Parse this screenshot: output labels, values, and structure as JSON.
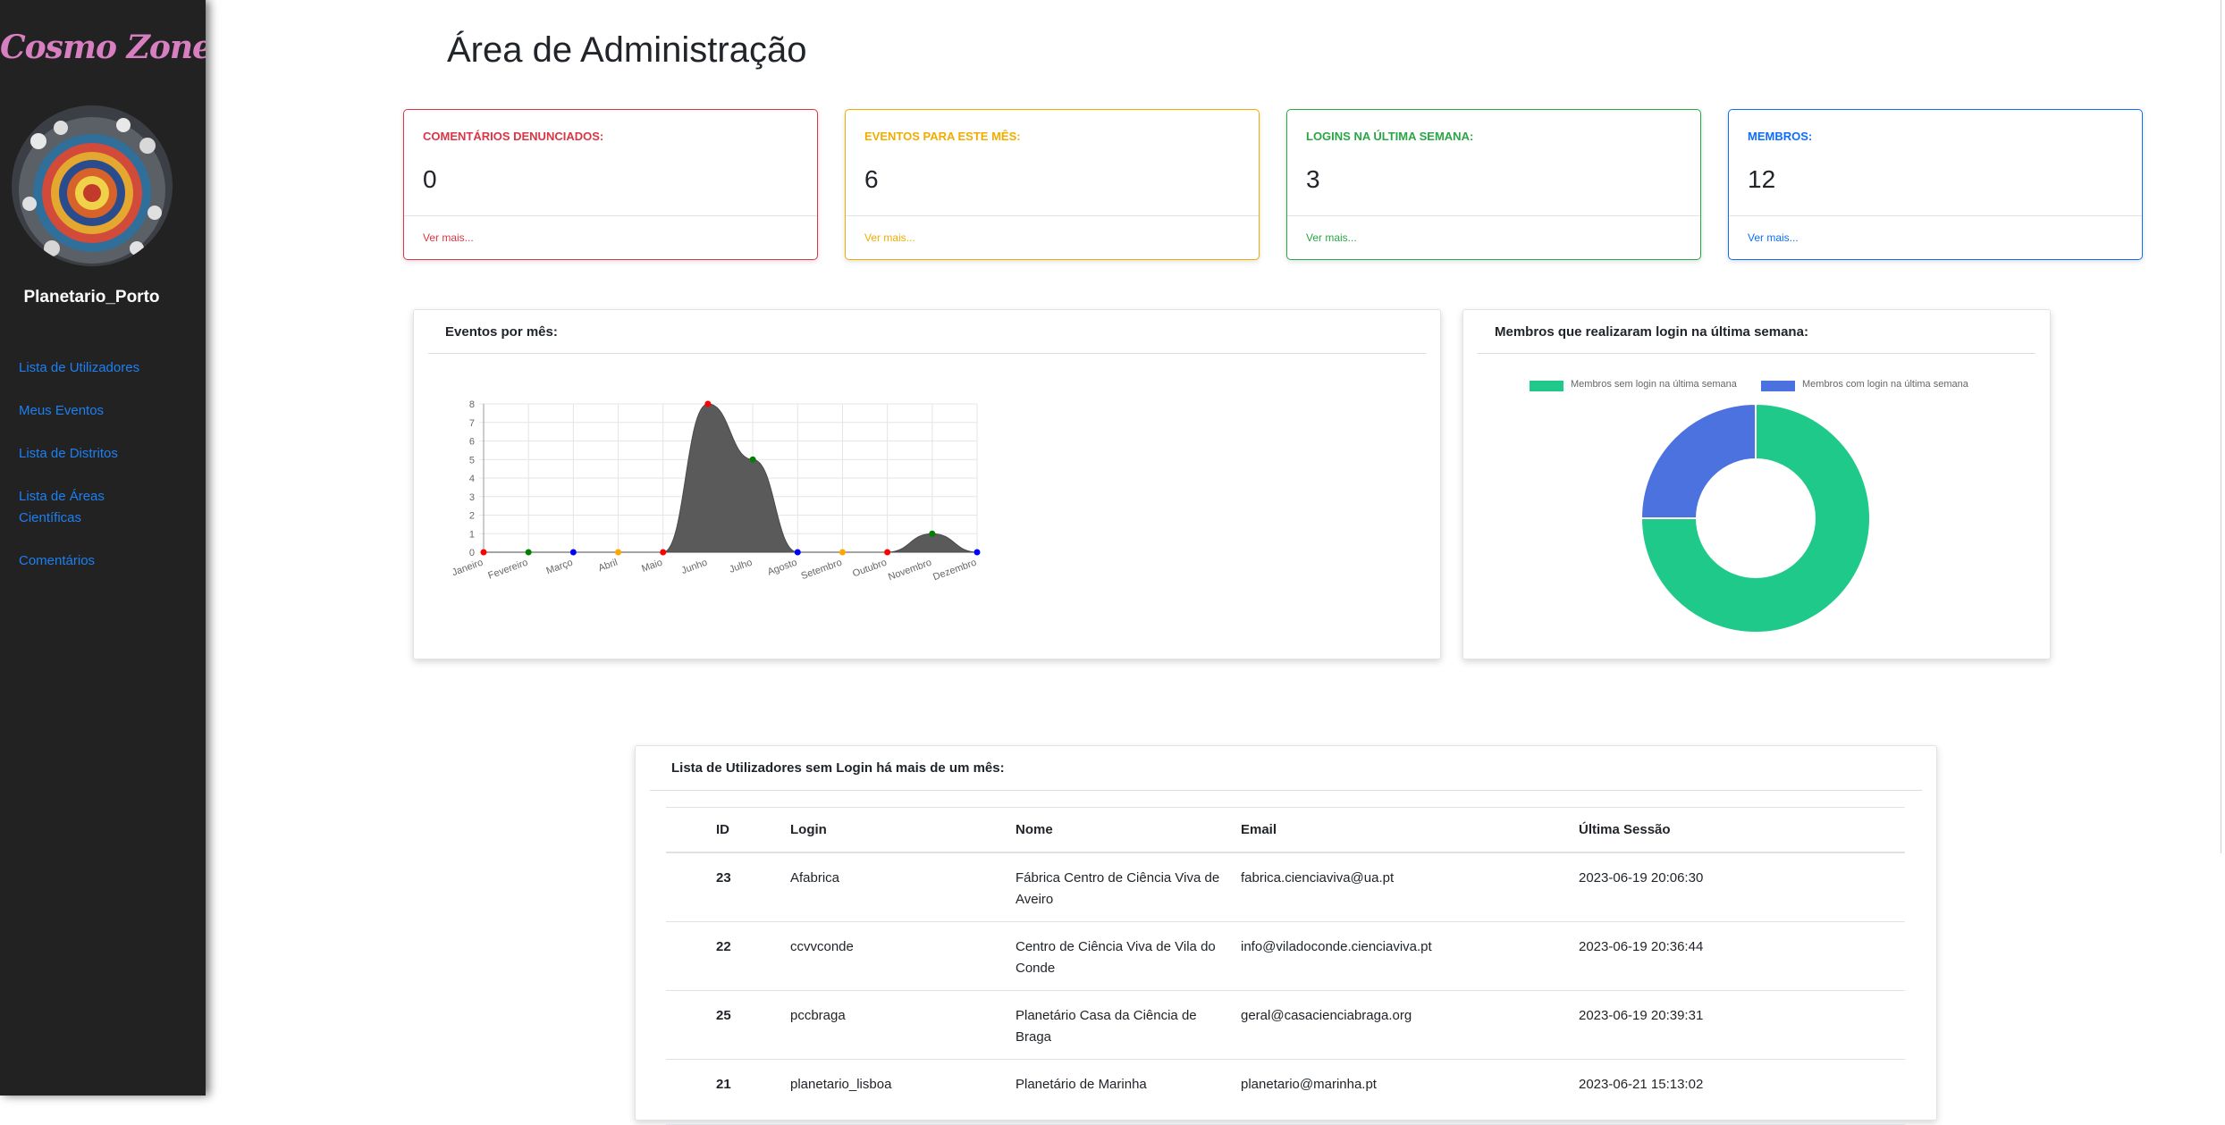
{
  "app": {
    "brand": "Cosmo Zone",
    "username": "Planetario_Porto"
  },
  "sidebar": {
    "items": [
      {
        "label": "Lista de Utilizadores"
      },
      {
        "label": "Meus Eventos"
      },
      {
        "label": "Lista de Distritos"
      },
      {
        "label": "Lista de Áreas Científicas"
      },
      {
        "label": "Comentários"
      }
    ]
  },
  "page": {
    "title": "Área de Administração"
  },
  "stats": [
    {
      "label": "Comentários denunciados:",
      "value": "0",
      "link": "Ver mais...",
      "color": "#dc3545"
    },
    {
      "label": "Eventos para este mês:",
      "value": "6",
      "link": "Ver mais...",
      "color": "#f0ad00"
    },
    {
      "label": "Logins na última semana:",
      "value": "3",
      "link": "Ver mais...",
      "color": "#28a745"
    },
    {
      "label": "Membros:",
      "value": "12",
      "link": "Ver mais...",
      "color": "#0d6efd"
    }
  ],
  "events_panel": {
    "title": "Eventos por mês:"
  },
  "logins_panel": {
    "title": "Membros que realizaram login na última semana:"
  },
  "chart_data": [
    {
      "type": "area",
      "categories": [
        "Janeiro",
        "Fevereiro",
        "Março",
        "Abril",
        "Maio",
        "Junho",
        "Julho",
        "Agosto",
        "Setembro",
        "Outubro",
        "Novembro",
        "Dezembro"
      ],
      "values": [
        0,
        0,
        0,
        0,
        0,
        8,
        5,
        0,
        0,
        0,
        1,
        0
      ],
      "point_colors": [
        "#ff0000",
        "#008000",
        "#0000ff",
        "#ffa500",
        "#ff0000",
        "#ff0000",
        "#008000",
        "#0000ff",
        "#ffa500",
        "#ff0000",
        "#008000",
        "#0000ff"
      ],
      "yticks": [
        "0",
        "1",
        "2",
        "3",
        "4",
        "5",
        "6",
        "7",
        "8"
      ],
      "ylim": [
        0,
        8
      ],
      "fill_color": "#5a5a5a",
      "grid": true
    },
    {
      "type": "pie",
      "legend": "top",
      "labels": [
        "Membros sem login na última semana",
        "Membros com login na última semana"
      ],
      "values": [
        9,
        3
      ],
      "colors": [
        "#1ec98a",
        "#4c72df"
      ]
    }
  ],
  "users_table": {
    "title": "Lista de Utilizadores sem Login há mais de um mês:",
    "headers": [
      "ID",
      "Login",
      "Nome",
      "Email",
      "Última Sessão"
    ],
    "rows": [
      [
        "23",
        "Afabrica",
        "Fábrica Centro de Ciência Viva de Aveiro",
        "fabrica.cienciaviva@ua.pt",
        "2023-06-19 20:06:30"
      ],
      [
        "22",
        "ccvvconde",
        "Centro de Ciência Viva de Vila do Conde",
        "info@viladoconde.cienciaviva.pt",
        "2023-06-19 20:36:44"
      ],
      [
        "25",
        "pccbraga",
        "Planetário Casa da Ciência de Braga",
        "geral@casacienciabraga.org",
        "2023-06-19 20:39:31"
      ],
      [
        "21",
        "planetario_lisboa",
        "Planetário de Marinha",
        "planetario@marinha.pt",
        "2023-06-21 15:13:02"
      ]
    ]
  }
}
